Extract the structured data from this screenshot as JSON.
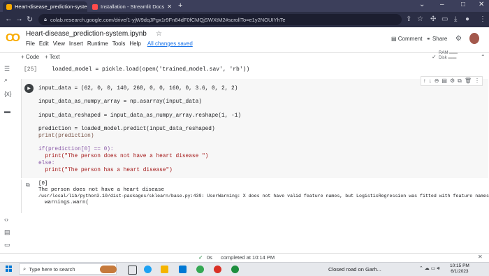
{
  "browser": {
    "tabs": [
      {
        "label": "Heart-disease_prediction-system",
        "favicon_color": "#f9ab00",
        "active": true
      },
      {
        "label": "Installation - Streamlit Docs",
        "favicon_color": "#ff4b4b",
        "active": false
      }
    ],
    "new_tab": "+",
    "url": "colab.research.google.com/drive/1-yjW9dqJPgx1r9Fn84dF0fCMQjSWXtM2#scrollTo=e1y2NOUIYhTe",
    "window_controls": {
      "minimize": "⌄",
      "maximize": "–",
      "restore": "□",
      "close": "✕"
    }
  },
  "colab": {
    "notebook_title": "Heart-disease_prediction-system.ipynb",
    "menu": [
      "File",
      "Edit",
      "View",
      "Insert",
      "Runtime",
      "Tools",
      "Help"
    ],
    "save_status": "All changes saved",
    "comment_label": "Comment",
    "share_label": "Share",
    "add_code": "+ Code",
    "add_text": "+ Text",
    "ram_label": "RAM",
    "disk_label": "Disk"
  },
  "cells": [
    {
      "exec_count": "[25]",
      "code": "loaded_model = pickle.load(open('trained_model.sav', 'rb'))"
    },
    {
      "lines": [
        "input_data = (62, 0, 0, 140, 268, 0, 0, 160, 0, 3.6, 0, 2, 2)",
        "",
        "input_data_as_numpy_array = np.asarray(input_data)",
        "",
        "input_data_reshaped = input_data_as_numpy_array.reshape(1, -1)",
        "",
        "prediction = loaded_model.predict(input_data_reshaped)",
        "print(prediction)",
        "",
        "if(prediction[0] == 0):",
        "  print(\"The person does not have a heart disease \")",
        "else:",
        "  print(\"The person has a heart disease\")"
      ],
      "output": [
        "[0]",
        "The person does not have a heart disease",
        "/usr/local/lib/python3.10/dist-packages/sklearn/base.py:439: UserWarning: X does not have valid feature names, but LogisticRegression was fitted with feature names",
        "  warnings.warn("
      ]
    }
  ],
  "status_bar": {
    "time": "0s",
    "completed": "completed at 10:14 PM"
  },
  "taskbar": {
    "search_placeholder": "Type here to search",
    "weather": "Closed road on Garh...",
    "time": "10:15 PM",
    "date": "6/1/2023"
  }
}
